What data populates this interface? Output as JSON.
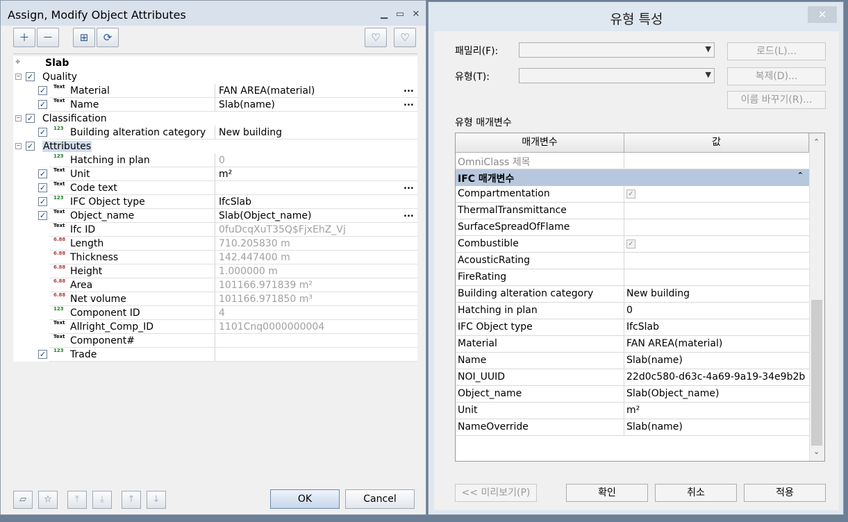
{
  "left_dialog": {
    "title": "Assign, Modify Object Attributes",
    "root_label": "Slab",
    "rows": [
      {
        "kind": "group",
        "label": "Quality"
      },
      {
        "kind": "attr",
        "label": "Material",
        "value": "FAN AREA(material)",
        "checked": true,
        "type": "Text"
      },
      {
        "kind": "attr",
        "label": "Name",
        "value": "Slab(name)",
        "checked": true,
        "type": "Text"
      },
      {
        "kind": "group",
        "label": "Classification"
      },
      {
        "kind": "attr",
        "label": "Building alteration category",
        "value": "New building",
        "checked": true,
        "type": "123"
      },
      {
        "kind": "group",
        "label": "Attributes"
      },
      {
        "kind": "attr",
        "label": "Hatching in plan",
        "value": "0",
        "checked": false,
        "type": "123"
      },
      {
        "kind": "attr",
        "label": "Unit",
        "value": "m²",
        "checked": true,
        "type": "Text"
      },
      {
        "kind": "attr",
        "label": "Code text",
        "value": "",
        "checked": true,
        "type": "Text"
      },
      {
        "kind": "attr",
        "label": "IFC Object type",
        "value": "IfcSlab",
        "checked": true,
        "type": "123"
      },
      {
        "kind": "attr",
        "label": "Object_name",
        "value": "Slab(Object_name)",
        "checked": true,
        "type": "Text"
      },
      {
        "kind": "attr",
        "label": "Ifc ID",
        "value": "0fuDcqXuT35Q$FjxEhZ_Vj",
        "checked": false,
        "type": "Text"
      },
      {
        "kind": "attr",
        "label": "Length",
        "value": "710.205830 m",
        "checked": false,
        "type": "6.88"
      },
      {
        "kind": "attr",
        "label": "Thickness",
        "value": "142.447400 m",
        "checked": false,
        "type": "6.88"
      },
      {
        "kind": "attr",
        "label": "Height",
        "value": "1.000000 m",
        "checked": false,
        "type": "6.88"
      },
      {
        "kind": "attr",
        "label": "Area",
        "value": "101166.971839 m²",
        "checked": false,
        "type": "6.88"
      },
      {
        "kind": "attr",
        "label": "Net volume",
        "value": "101166.971850 m³",
        "checked": false,
        "type": "6.88"
      },
      {
        "kind": "attr",
        "label": "Component ID",
        "value": "4",
        "checked": false,
        "type": "123"
      },
      {
        "kind": "attr",
        "label": "Allright_Comp_ID",
        "value": "1101Cnq0000000004",
        "checked": false,
        "type": "Text"
      },
      {
        "kind": "attr",
        "label": "Component#",
        "value": "",
        "checked": false,
        "type": "Text"
      },
      {
        "kind": "attr",
        "label": "Trade",
        "value": "",
        "checked": true,
        "type": "123"
      }
    ],
    "ok_label": "OK",
    "cancel_label": "Cancel"
  },
  "right_dialog": {
    "title": "유형 특성",
    "close_glyph": "✕",
    "family_label": "패밀리(F):",
    "type_label": "유형(T):",
    "load_label": "로드(L)...",
    "duplicate_label": "복제(D)...",
    "rename_label": "이름 바꾸기(R)...",
    "type_params_label": "유형 매개변수",
    "col_param": "매개변수",
    "col_value": "값",
    "omniclass_label": "OmniClass 제목",
    "group_label": "IFC 매개변수",
    "rows": [
      {
        "param": "Compartmentation",
        "value": "",
        "check": true
      },
      {
        "param": "ThermalTransmittance",
        "value": ""
      },
      {
        "param": "SurfaceSpreadOfFlame",
        "value": ""
      },
      {
        "param": "Combustible",
        "value": "",
        "check": true
      },
      {
        "param": "AcousticRating",
        "value": ""
      },
      {
        "param": "FireRating",
        "value": ""
      },
      {
        "param": "Building alteration category",
        "value": "New building"
      },
      {
        "param": "Hatching in plan",
        "value": "0"
      },
      {
        "param": "IFC Object type",
        "value": "IfcSlab"
      },
      {
        "param": "Material",
        "value": "FAN AREA(material)"
      },
      {
        "param": "Name",
        "value": "Slab(name)"
      },
      {
        "param": "NOI_UUID",
        "value": "22d0c580-d63c-4a69-9a19-34e9b2b"
      },
      {
        "param": "Object_name",
        "value": "Slab(Object_name)"
      },
      {
        "param": "Unit",
        "value": "m²"
      },
      {
        "param": "NameOverride",
        "value": "Slab(name)"
      }
    ],
    "preview_label": "<< 미리보기(P)",
    "ok_label": "확인",
    "cancel_label": "취소",
    "apply_label": "적용"
  }
}
